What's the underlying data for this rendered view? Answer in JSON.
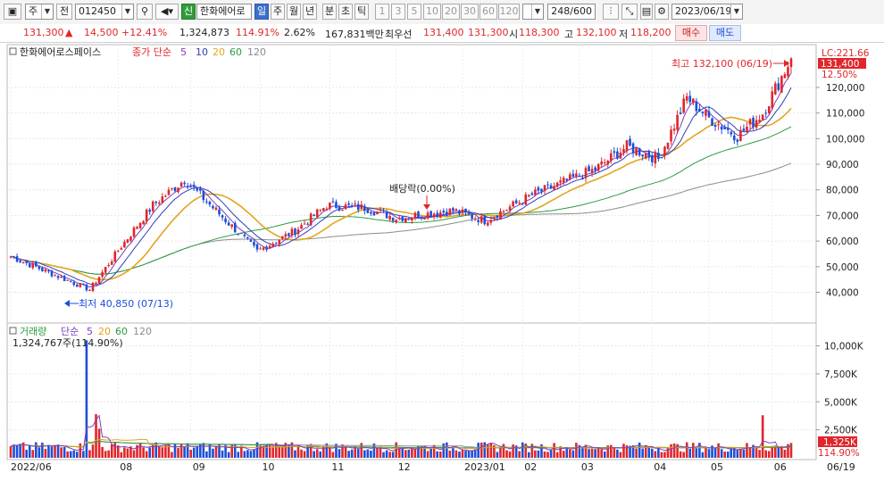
{
  "toolbar": {
    "period_type": "주",
    "prev_label": "전",
    "code": "012450",
    "new_badge": "신",
    "stock_name": "한화에어로",
    "periods": [
      "일",
      "주",
      "월",
      "년",
      "분",
      "초",
      "틱"
    ],
    "active_period": "일",
    "intervals": [
      "1",
      "3",
      "5",
      "10",
      "20",
      "30",
      "60",
      "120"
    ],
    "count_value": "248",
    "count_total": "/600",
    "date": "2023/06/19"
  },
  "info": {
    "price": "131,300",
    "change": "14,500",
    "change_pct": "+12.41%",
    "volume": "1,324,873",
    "volume_ratio": "114.91%",
    "turnover": "2.62%",
    "trade_value": "167,831백만",
    "best_label": "최우선",
    "best_ask": "131,400",
    "best_bid": "131,300",
    "open_label": "시",
    "open": "118,300",
    "high_label": "고",
    "high": "132,100",
    "low_label": "저",
    "low": "118,200",
    "buy_label": "매수",
    "sell_label": "매도"
  },
  "price_legend": {
    "title": "한화에어로스페이스",
    "series": "종가 단순",
    "ma": [
      "5",
      "10",
      "20",
      "60",
      "120"
    ]
  },
  "price_annotations": {
    "high": "최고 132,100 (06/19)",
    "low": "최저 40,850 (07/13)",
    "dividend": "배당락(0.00%)"
  },
  "price_axis": {
    "lc_label": "LC:221.66",
    "last_price_tag": "131,400",
    "percent_tag": "12.50%",
    "ticks": [
      "120,000",
      "110,000",
      "100,000",
      "90,000",
      "80,000",
      "70,000",
      "60,000",
      "50,000",
      "40,000"
    ]
  },
  "volume_legend": {
    "title": "거래량",
    "series": "단순",
    "ma": [
      "5",
      "20",
      "60",
      "120"
    ],
    "value_line": "1,324,767주(114.90%)"
  },
  "volume_axis": {
    "ticks": [
      "10,000K",
      "7,500K",
      "5,000K",
      "2,500K"
    ],
    "last_tag": "1,325K",
    "pct_tag": "114.90%"
  },
  "x_axis": {
    "labels": [
      "2022/06",
      "08",
      "09",
      "10",
      "11",
      "12",
      "2023/01",
      "02",
      "03",
      "04",
      "05",
      "06"
    ],
    "right_label": "06/19"
  },
  "colors": {
    "up": "#e0262b",
    "down": "#1c4fd8",
    "ma5": "#7b3fbf",
    "ma10": "#2f3fb8",
    "ma20": "#e3a41e",
    "ma60": "#2c9b3f",
    "ma120": "#8c8c8c"
  },
  "chart_data": {
    "type": "candlestick",
    "title": "한화에어로스페이스",
    "x_start": "2022/06",
    "x_end": "2023/06/19",
    "price_ylim": [
      36000,
      132100
    ],
    "price_anchors": [
      [
        "2022/06",
        54000
      ],
      [
        "2022/07/13",
        41000
      ],
      [
        "2022/08",
        58000
      ],
      [
        "2022/08/mid",
        74000
      ],
      [
        "2022/09/mid",
        84000
      ],
      [
        "2022/10/mid",
        56000
      ],
      [
        "2022/11",
        64000
      ],
      [
        "2022/11/mid",
        74000
      ],
      [
        "2022/12",
        73000
      ],
      [
        "2022/12/mid",
        69000
      ],
      [
        "2023/01",
        72000
      ],
      [
        "2023/01/mid",
        68000
      ],
      [
        "2023/02",
        78000
      ],
      [
        "2023/03",
        88000
      ],
      [
        "2023/03/mid",
        97000
      ],
      [
        "2023/04",
        92000
      ],
      [
        "2023/04/mid",
        116000
      ],
      [
        "2023/05",
        108000
      ],
      [
        "2023/05/mid",
        101000
      ],
      [
        "2023/06",
        110000
      ],
      [
        "2023/06/19",
        131300
      ]
    ],
    "volume_ylim": [
      0,
      11000000
    ],
    "volume_peaks": [
      [
        "2022/07",
        10500000
      ],
      [
        "2023/06",
        3800000
      ],
      [
        "2022/08",
        3900000
      ]
    ],
    "last_volume": 1324767
  }
}
